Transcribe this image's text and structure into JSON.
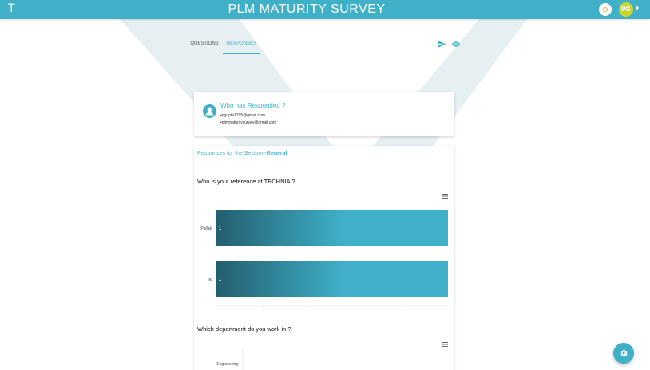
{
  "app": {
    "logo_letter": "T",
    "title": "PLM MATURITY SURVEY",
    "avatar_initials": "PG",
    "brand_color": "#3fb0c8"
  },
  "tabs": [
    {
      "label": "QUESTIONS",
      "active": false
    },
    {
      "label": "RESPONSES",
      "active": true
    }
  ],
  "toolbar_icons": [
    "send-icon",
    "eye-icon"
  ],
  "respondents": {
    "title": "Who has Responded ?",
    "emails": [
      "pgupta1795@gmail.com",
      "plmmaturitysurvey@gmail.com"
    ]
  },
  "section": {
    "prefix": "Responses for the Section -",
    "name": "General"
  },
  "questions": [
    {
      "text": "Who is your reference at TECHNIA ?",
      "chart_data": {
        "type": "bar",
        "orientation": "horizontal",
        "categories": [
          "Pallak",
          "jk"
        ],
        "values": [
          1,
          1
        ],
        "gradient": [
          "#235e6e",
          "#3fb0c8"
        ]
      }
    },
    {
      "text": "Which department do you work in ?",
      "chart_data": {
        "type": "bar",
        "orientation": "horizontal",
        "categories": [
          "Engineering"
        ],
        "values": []
      }
    }
  ]
}
